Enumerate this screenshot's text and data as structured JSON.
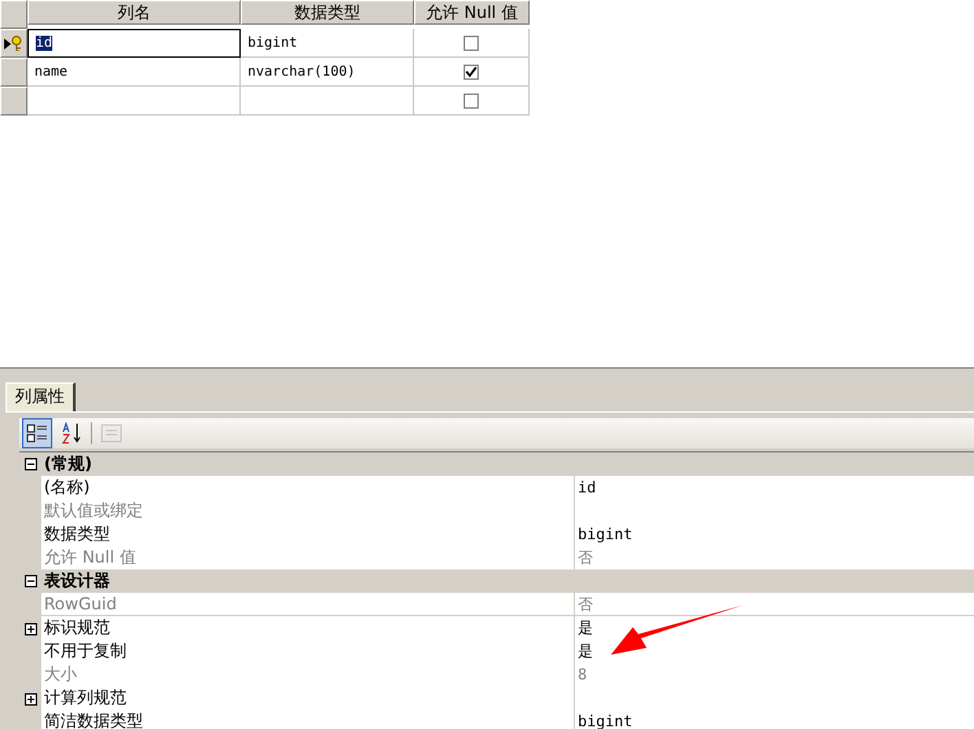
{
  "columns_grid": {
    "headers": [
      "列名",
      "数据类型",
      "允许 Null 值"
    ],
    "rows": [
      {
        "name": "id",
        "type": "bigint",
        "allow_null": false,
        "selected": true,
        "primary_key": true
      },
      {
        "name": "name",
        "type": "nvarchar(100)",
        "allow_null": true,
        "selected": false,
        "primary_key": false
      },
      {
        "allow_null": false,
        "selected": false,
        "primary_key": false
      }
    ]
  },
  "properties_panel": {
    "tab": {
      "label": "列属性",
      "selected": true
    },
    "toolbar": [
      {
        "kind": "categorized",
        "selected": true
      },
      {
        "kind": "alphabetical",
        "selected": false
      },
      {
        "kind": "pages",
        "disabled": true
      }
    ],
    "rows": [
      {
        "kind": "category",
        "label": "(常规)",
        "expanded": true
      },
      {
        "kind": "property",
        "label": "(名称)",
        "value": "id",
        "disabled": false
      },
      {
        "kind": "property",
        "label": "默认值或绑定",
        "disabled": true
      },
      {
        "kind": "property",
        "label": "数据类型",
        "value": "bigint",
        "disabled": false
      },
      {
        "kind": "property",
        "label": "允许 Null 值",
        "value": "否",
        "disabled": true
      },
      {
        "kind": "category",
        "label": "表设计器",
        "expanded": true
      },
      {
        "kind": "property",
        "label": "RowGuid",
        "value": "否",
        "disabled": true
      },
      {
        "kind": "property",
        "label": "标识规范",
        "value": "是",
        "disabled": false,
        "expanded": false
      },
      {
        "kind": "property",
        "label": "不用于复制",
        "value": "是",
        "disabled": false
      },
      {
        "kind": "property",
        "label": "大小",
        "value": "8",
        "disabled": true
      },
      {
        "kind": "property",
        "label": "计算列规范",
        "disabled": false,
        "expanded": false
      },
      {
        "kind": "property",
        "label": "简洁数据类型",
        "value": "bigint",
        "disabled": false
      }
    ]
  }
}
